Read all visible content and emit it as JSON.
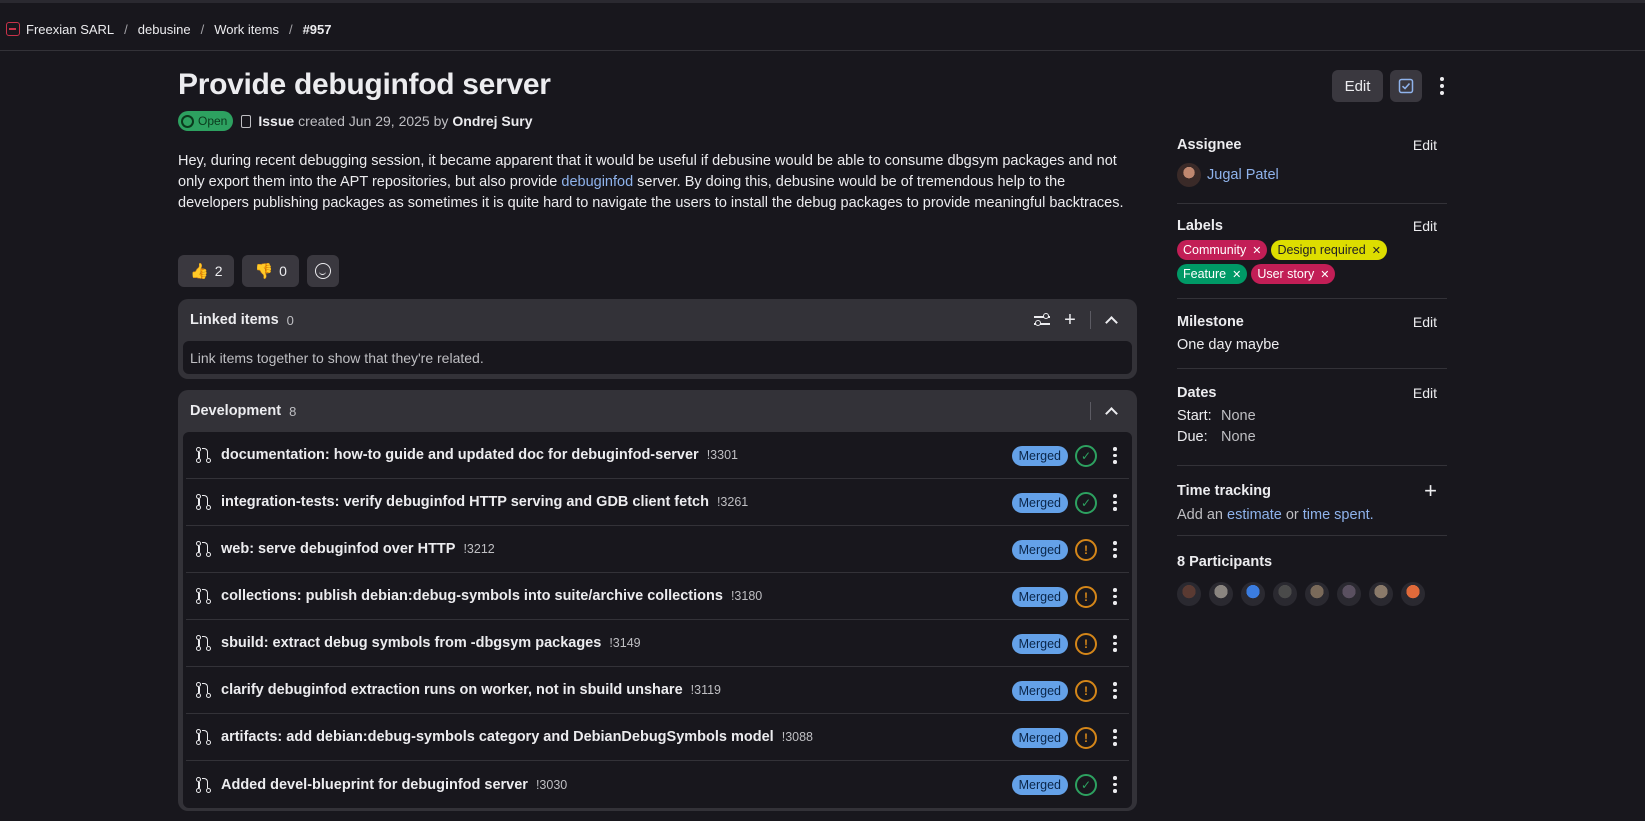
{
  "breadcrumb": {
    "items": [
      "Freexian SARL",
      "debusine",
      "Work items"
    ],
    "current": "#957"
  },
  "issue": {
    "title": "Provide debuginfod server",
    "status": "Open",
    "type": "Issue",
    "created_text": "created Jun 29, 2025 by",
    "author": "Ondrej Sury",
    "description_part1": "Hey, during recent debugging session, it became apparent that it would be useful if debusine would be able to consume dbgsym packages and not only export them into the APT repositories, but also provide ",
    "description_link": "debuginfod",
    "description_part2": " server. By doing this, debusine would be of tremendous help to the developers publishing packages as sometimes it is quite hard to navigate the users to install the debug packages to provide meaningful backtraces."
  },
  "header_actions": {
    "edit_label": "Edit"
  },
  "reactions": {
    "thumbs_up": {
      "emoji": "👍",
      "count": "2"
    },
    "thumbs_down": {
      "emoji": "👎",
      "count": "0"
    }
  },
  "linked_items": {
    "title": "Linked items",
    "count": "0",
    "empty_text": "Link items together to show that they're related."
  },
  "development": {
    "title": "Development",
    "count": "8",
    "merge_requests": [
      {
        "title": "documentation: how-to guide and updated doc for debuginfod-server",
        "ref": "!3301",
        "status": "Merged",
        "pipeline": "success"
      },
      {
        "title": "integration-tests: verify debuginfod HTTP serving and GDB client fetch",
        "ref": "!3261",
        "status": "Merged",
        "pipeline": "success"
      },
      {
        "title": "web: serve debuginfod over HTTP",
        "ref": "!3212",
        "status": "Merged",
        "pipeline": "warning"
      },
      {
        "title": "collections: publish debian:debug-symbols into suite/archive collections",
        "ref": "!3180",
        "status": "Merged",
        "pipeline": "warning"
      },
      {
        "title": "sbuild: extract debug symbols from -dbgsym packages",
        "ref": "!3149",
        "status": "Merged",
        "pipeline": "warning"
      },
      {
        "title": "clarify debuginfod extraction runs on worker, not in sbuild unshare",
        "ref": "!3119",
        "status": "Merged",
        "pipeline": "warning"
      },
      {
        "title": "artifacts: add debian:debug-symbols category and DebianDebugSymbols model",
        "ref": "!3088",
        "status": "Merged",
        "pipeline": "warning"
      },
      {
        "title": "Added devel-blueprint for debuginfod server",
        "ref": "!3030",
        "status": "Merged",
        "pipeline": "success"
      }
    ]
  },
  "sidebar": {
    "edit_label": "Edit",
    "assignee": {
      "title": "Assignee",
      "name": "Jugal Patel"
    },
    "labels": {
      "title": "Labels",
      "items": [
        {
          "text": "Community",
          "bg": "#c21e56",
          "fg": "#ffffff"
        },
        {
          "text": "Design required",
          "bg": "#dddd00",
          "fg": "#1f1e24"
        },
        {
          "text": "Feature",
          "bg": "#009966",
          "fg": "#ffffff"
        },
        {
          "text": "User story",
          "bg": "#c21e56",
          "fg": "#ffffff"
        }
      ]
    },
    "milestone": {
      "title": "Milestone",
      "value": "One day maybe"
    },
    "dates": {
      "title": "Dates",
      "start_label": "Start:",
      "start_value": "None",
      "due_label": "Due:",
      "due_value": "None"
    },
    "time_tracking": {
      "title": "Time tracking",
      "text_prefix": "Add an ",
      "estimate_link": "estimate",
      "text_mid": " or ",
      "spent_link": "time spent."
    },
    "participants": {
      "title": "8 Participants",
      "colors": [
        "#5a3a32",
        "#8a8580",
        "#3b7de0",
        "#4a4a4a",
        "#7a6a5a",
        "#5a5060",
        "#8a7a6a",
        "#e06a3a"
      ]
    }
  },
  "colors": {
    "accent_link": "#8fb3ec",
    "merged": "#64a1e8",
    "success": "#2da160",
    "warning": "#d48619"
  }
}
